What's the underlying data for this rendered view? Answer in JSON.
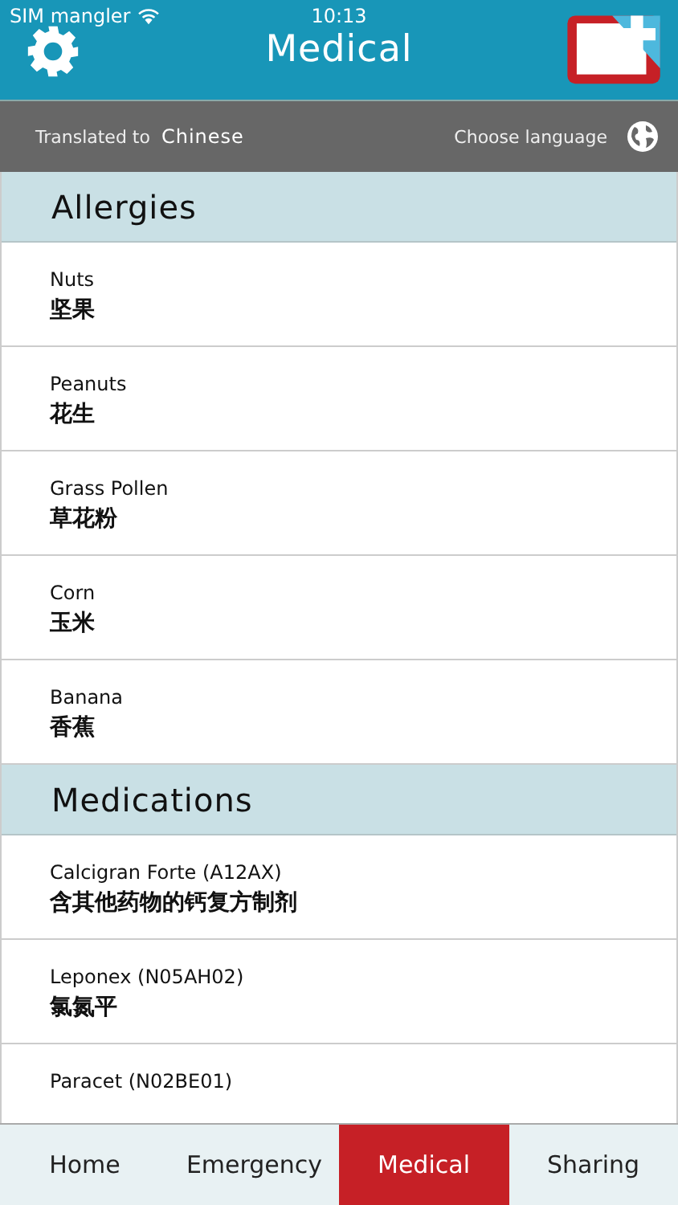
{
  "status_bar": {
    "carrier": "SIM mangler",
    "time": "10:13"
  },
  "header": {
    "title": "Medical"
  },
  "language_bar": {
    "label": "Translated to",
    "language": "Chinese",
    "action": "Choose language"
  },
  "sections": [
    {
      "title": "Allergies",
      "items": [
        {
          "name": "Nuts",
          "translation": "坚果"
        },
        {
          "name": "Peanuts",
          "translation": "花生"
        },
        {
          "name": "Grass Pollen",
          "translation": "草花粉"
        },
        {
          "name": "Corn",
          "translation": "玉米"
        },
        {
          "name": "Banana",
          "translation": "香蕉"
        }
      ]
    },
    {
      "title": "Medications",
      "items": [
        {
          "name": "Calcigran Forte  (A12AX)",
          "translation": "含其他药物的钙复方制剂"
        },
        {
          "name": "Leponex  (N05AH02)",
          "translation": "氯氮平"
        },
        {
          "name": "Paracet  (N02BE01)"
        }
      ]
    }
  ],
  "tabs": [
    {
      "label": "Home",
      "selected": false
    },
    {
      "label": "Emergency",
      "selected": false
    },
    {
      "label": "Medical",
      "selected": true
    },
    {
      "label": "Sharing",
      "selected": false
    }
  ]
}
